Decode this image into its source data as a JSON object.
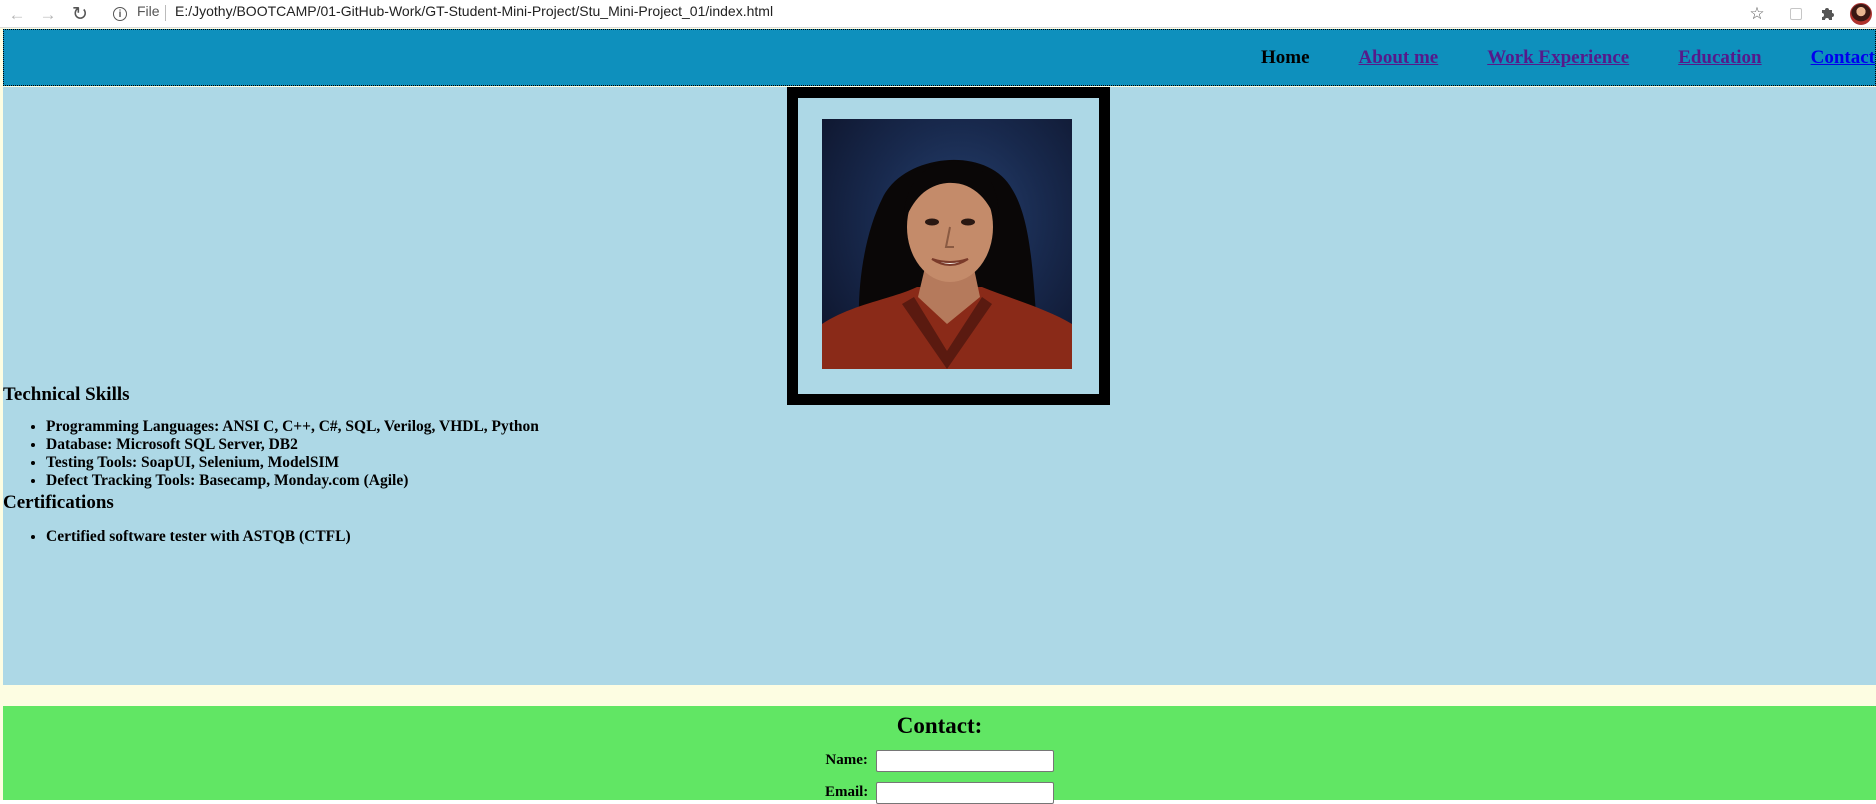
{
  "browser": {
    "file_label": "File",
    "url": "E:/Jyothy/BOOTCAMP/01-GitHub-Work/GT-Student-Mini-Project/Stu_Mini-Project_01/index.html"
  },
  "nav": {
    "home": "Home",
    "about": "About me",
    "work": "Work Experience",
    "education": "Education",
    "contact": "Contact"
  },
  "skills": {
    "title": "Technical Skills",
    "items": [
      "Programming Languages: ANSI C, C++, C#, SQL, Verilog, VHDL, Python",
      "Database: Microsoft SQL Server, DB2",
      "Testing Tools: SoapUI, Selenium, ModelSIM",
      "Defect Tracking Tools: Basecamp, Monday.com (Agile)"
    ]
  },
  "certifications": {
    "title": "Certifications",
    "items": [
      "Certified software tester with ASTQB (CTFL)"
    ]
  },
  "contact": {
    "title": "Contact:",
    "name_label": "Name:",
    "email_label": "Email:",
    "name_value": "",
    "email_value": ""
  },
  "colors": {
    "header": "#0e90bd",
    "main": "#add8e6",
    "band": "#fdfde2",
    "contact": "#61e664"
  }
}
